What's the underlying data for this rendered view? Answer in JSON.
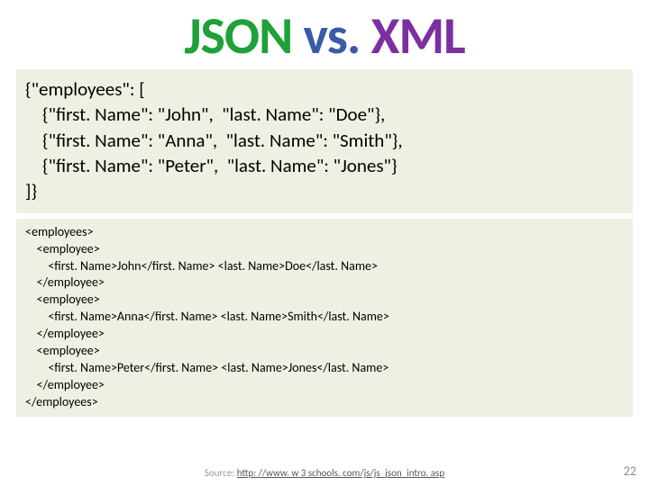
{
  "title": {
    "json": "JSON",
    "vs": "vs.",
    "xml": "XML"
  },
  "jsonCode": "{\"employees\": [\n    {\"first. Name\": \"John\",  \"last. Name\": \"Doe\"},\n    {\"first. Name\": \"Anna\",  \"last. Name\": \"Smith\"},\n    {\"first. Name\": \"Peter\",  \"last. Name\": \"Jones\"}\n]}",
  "xmlCode": "<employees>\n    <employee>\n        <first. Name>John</first. Name> <last. Name>Doe</last. Name>\n    </employee>\n    <employee>\n        <first. Name>Anna</first. Name> <last. Name>Smith</last. Name>\n    </employee>\n    <employee>\n        <first. Name>Peter</first. Name> <last. Name>Jones</last. Name>\n    </employee>\n</employees>",
  "sourceLabel": "Source:",
  "sourceUrl": "http: //www. w 3 schools. com/js/js_json_intro. asp",
  "pageNumber": "22"
}
